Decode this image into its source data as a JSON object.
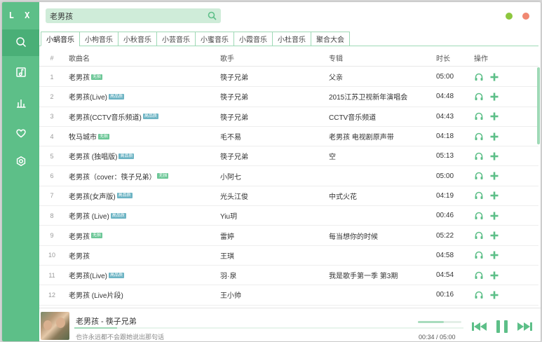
{
  "app": {
    "logo": "L X"
  },
  "sidebar": {
    "items": [
      {
        "name": "nav-search",
        "icon": "search-icon"
      },
      {
        "name": "nav-songlist",
        "icon": "music-note-icon"
      },
      {
        "name": "nav-charts",
        "icon": "chart-icon"
      },
      {
        "name": "nav-favorites",
        "icon": "heart-icon"
      },
      {
        "name": "nav-settings",
        "icon": "settings-icon"
      }
    ]
  },
  "search": {
    "value": "老男孩",
    "placeholder": ""
  },
  "tabs": [
    "小蜗音乐",
    "小枸音乐",
    "小秋音乐",
    "小芸音乐",
    "小蜜音乐",
    "小霞音乐",
    "小杜音乐",
    "聚合大会"
  ],
  "table": {
    "headers": {
      "num": "#",
      "name": "歌曲名",
      "singer": "歌手",
      "album": "专辑",
      "time": "时长",
      "ops": "操作"
    },
    "rows": [
      {
        "num": "1",
        "name": "老男孩",
        "badge": "无损",
        "badge_type": "lossless",
        "singer": "筷子兄弟",
        "album": "父亲",
        "time": "05:00"
      },
      {
        "num": "2",
        "name": "老男孩(Live)",
        "badge": "高品质",
        "badge_type": "hq",
        "singer": "筷子兄弟",
        "album": "2015江苏卫视新年演唱会",
        "time": "04:48"
      },
      {
        "num": "3",
        "name": "老男孩(CCTV音乐频道)",
        "badge": "高品质",
        "badge_type": "hq",
        "singer": "筷子兄弟",
        "album": "CCTV音乐频道",
        "time": "04:43"
      },
      {
        "num": "4",
        "name": "牧马城市",
        "badge": "无损",
        "badge_type": "lossless",
        "singer": "毛不易",
        "album": "老男孩 电视剧原声带",
        "time": "04:18"
      },
      {
        "num": "5",
        "name": "老男孩 (独唱版)",
        "badge": "高品质",
        "badge_type": "hq",
        "singer": "筷子兄弟",
        "album": "空",
        "time": "05:13"
      },
      {
        "num": "6",
        "name": "老男孩（cover：筷子兄弟）",
        "badge": "无损",
        "badge_type": "lossless",
        "singer": "小阿七",
        "album": "",
        "time": "05:00"
      },
      {
        "num": "7",
        "name": "老男孩(女声版)",
        "badge": "高品质",
        "badge_type": "hq",
        "singer": "光头江俊",
        "album": "中式火花",
        "time": "04:19"
      },
      {
        "num": "8",
        "name": "老男孩 (Live)",
        "badge": "高品质",
        "badge_type": "hq",
        "singer": "Yiu玥",
        "album": "",
        "time": "00:46"
      },
      {
        "num": "9",
        "name": "老男孩",
        "badge": "无损",
        "badge_type": "lossless",
        "singer": "雷婷",
        "album": "每当想你的时候",
        "time": "05:22"
      },
      {
        "num": "10",
        "name": "老男孩",
        "badge": "",
        "badge_type": "",
        "singer": "王琪",
        "album": "",
        "time": "04:58"
      },
      {
        "num": "11",
        "name": "老男孩(Live)",
        "badge": "高品质",
        "badge_type": "hq",
        "singer": "羽·泉",
        "album": "我是歌手第一季 第3期",
        "time": "04:54"
      },
      {
        "num": "12",
        "name": "老男孩 (Live片段)",
        "badge": "",
        "badge_type": "",
        "singer": "王小帅",
        "album": "",
        "time": "00:16"
      }
    ]
  },
  "player": {
    "title": "老男孩 - 筷子兄弟",
    "lyric": "也许永远都不会跟她说出那句话",
    "time": "00:34 / 05:00",
    "progress": 0.11,
    "volume": 0.6
  },
  "colors": {
    "accent": "#5dbf88",
    "accent_light": "#9fd9b6",
    "close": "#f08872",
    "minimize": "#8dc73f"
  }
}
